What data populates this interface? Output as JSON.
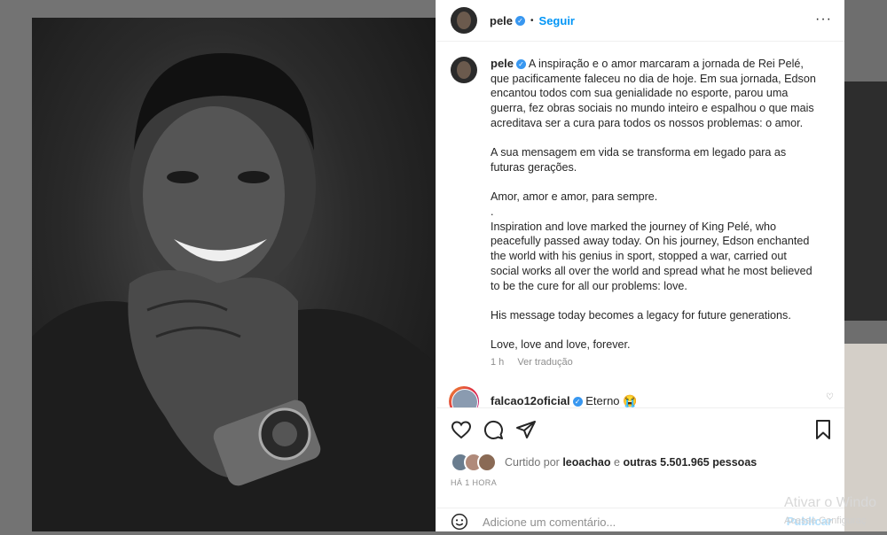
{
  "post": {
    "username": "pele",
    "follow_label": "Seguir",
    "caption_pt": "A inspiração e o amor marcaram a jornada de Rei Pelé,\nque pacificamente faleceu no dia de hoje. Em sua jornada, Edson\nencantou todos com sua genialidade no esporte, parou uma\nguerra, fez obras sociais no mundo inteiro e espalhou o que mais\nacreditava ser a cura para todos os nossos problemas: o amor.\n\nA sua mensagem em vida se transforma em legado para as\nfuturas gerações.\n\nAmor, amor e amor, para sempre.\n.\nInspiration and love marked the journey of King Pelé, who\npeacefully passed away today. On his journey, Edson enchanted\nthe world with his genius in sport, stopped a war, carried out\nsocial works all over the world and spread what he most believed\nto be the cure for all our problems: love.\n\nHis message today becomes a legacy for future generations.\n\nLove, love and love, forever.",
    "age": "1 h",
    "translate_label": "Ver tradução",
    "comment": {
      "username": "falcao12oficial",
      "text": "Eterno 😭"
    },
    "likes": {
      "prefix": "Curtido por",
      "user": "leoachao",
      "conj": "e",
      "others": "outras 5.501.965 pessoas"
    },
    "timestamp": "HÁ 1 HORA",
    "add_comment_placeholder": "Adicione um comentário...",
    "publish_label": "Publicar"
  },
  "overlay": {
    "windows_activate": "Ativar o Windo",
    "windows_settings": "Acesse Configuraç"
  },
  "icons": [
    "more-icon",
    "verified-icon",
    "like-icon",
    "comment-icon",
    "share-icon",
    "save-icon",
    "emoji-icon"
  ],
  "colors": {
    "link": "#0095f6",
    "verified": "#3897f0",
    "secondary_text": "#8e8e8e"
  }
}
